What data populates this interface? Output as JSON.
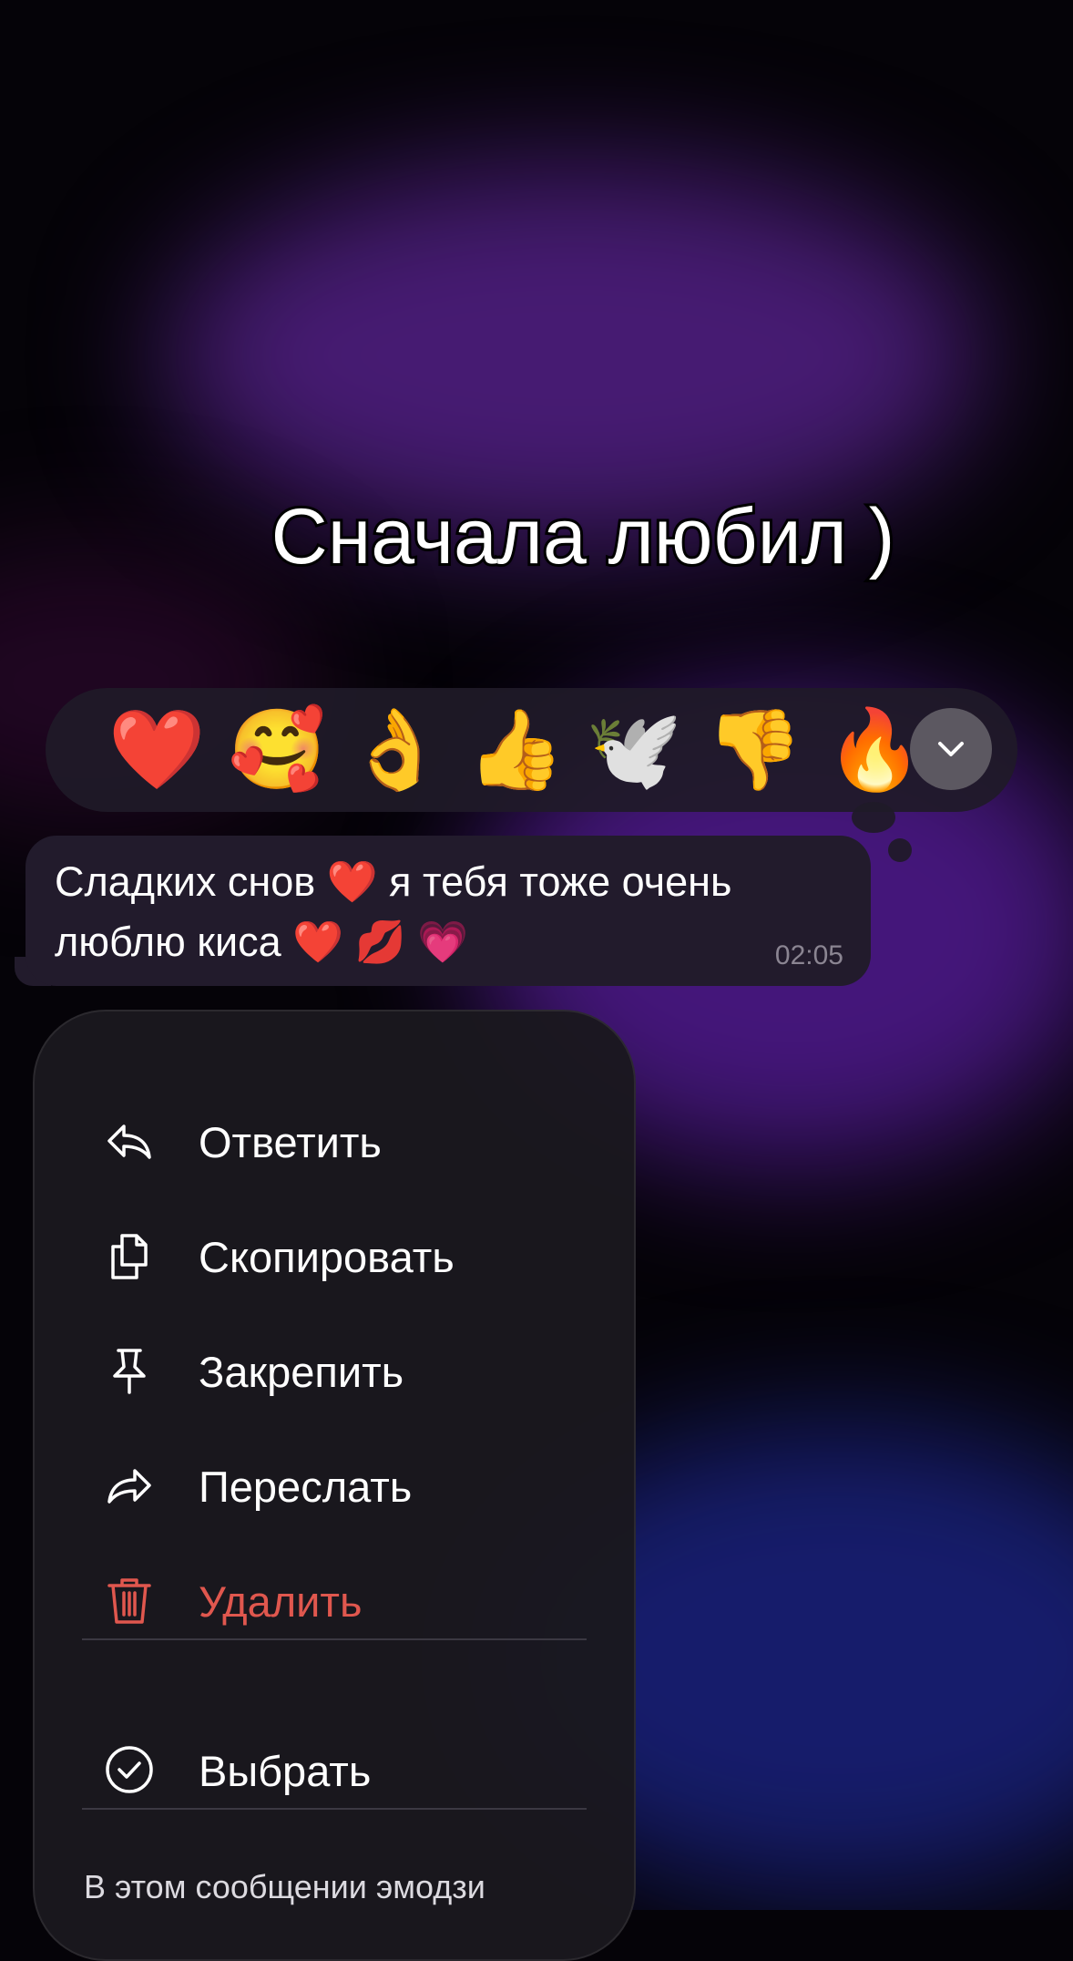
{
  "caption": "Сначала любил )",
  "reactions": [
    {
      "name": "red-heart",
      "glyph": "❤️"
    },
    {
      "name": "smiling-face-with-hearts",
      "glyph": "🥰"
    },
    {
      "name": "ok-hand",
      "glyph": "👌"
    },
    {
      "name": "thumbs-up",
      "glyph": "👍"
    },
    {
      "name": "dove",
      "glyph": "🕊️"
    },
    {
      "name": "thumbs-down",
      "glyph": "👎"
    },
    {
      "name": "fire",
      "glyph": "🔥"
    }
  ],
  "message": {
    "text": "Сладких снов ❤️ я тебя тоже очень люблю киса ❤️ 💋 💗",
    "time": "02:05"
  },
  "menu": {
    "reply": "Ответить",
    "copy": "Скопировать",
    "pin": "Закрепить",
    "forward": "Переслать",
    "delete": "Удалить",
    "select": "Выбрать",
    "note": "В этом сообщении эмодзи"
  },
  "colors": {
    "danger": "#e0574e",
    "bubble": "#221b2c",
    "menu_bg": "#1a181e"
  }
}
